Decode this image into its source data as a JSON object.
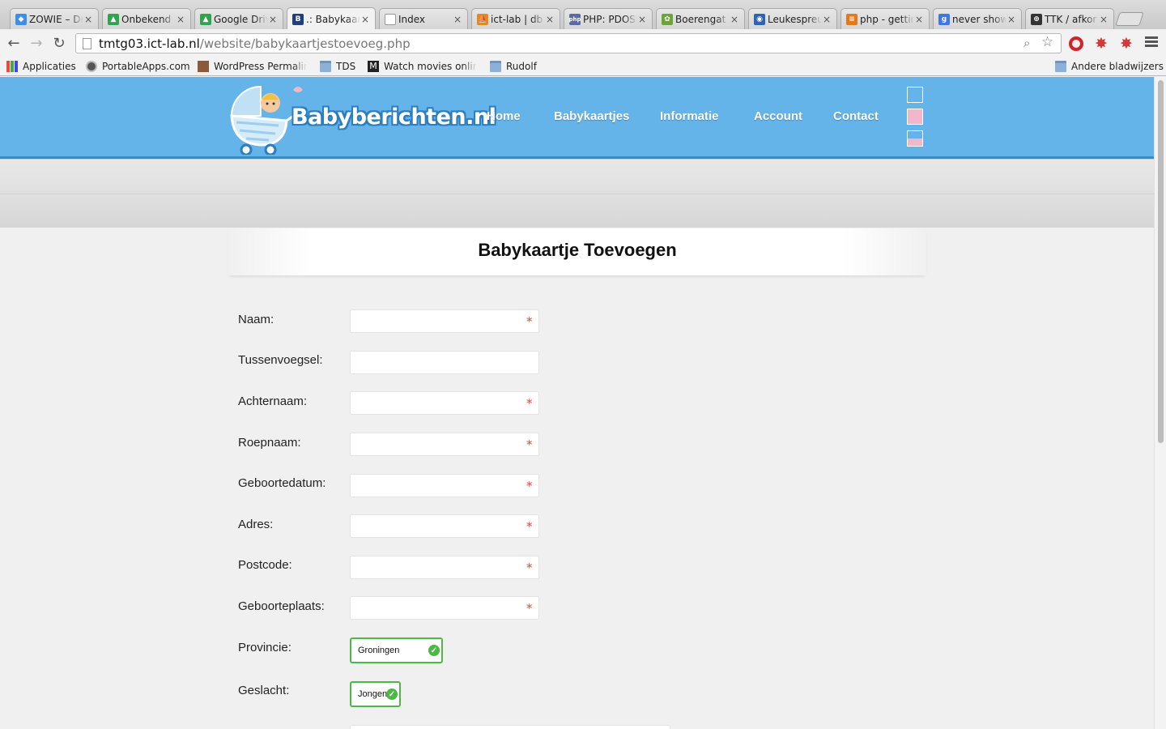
{
  "browser": {
    "tabs": [
      {
        "title": "ZOWIE – Dr",
        "favicon_color": "#3d8ee6",
        "favicon": "dropbox-icon"
      },
      {
        "title": "Onbekend -",
        "favicon_color": "#2fa44f",
        "favicon": "drive-icon"
      },
      {
        "title": "Google Driv",
        "favicon_color": "#2fa44f",
        "favicon": "drive-icon"
      },
      {
        "title": ".: Babykaart",
        "favicon_color": "#1e3f7a",
        "favicon": "b-icon",
        "favicon_glyph": "B"
      },
      {
        "title": "Index",
        "favicon_color": "#ffffff",
        "favicon": "page-icon"
      },
      {
        "title": "ict-lab | db",
        "favicon_color": "#e08a1f",
        "favicon": "pma-icon"
      },
      {
        "title": "PHP: PDOSt",
        "favicon_color": "#5b6aa3",
        "favicon": "php-icon",
        "favicon_glyph": "php"
      },
      {
        "title": "Boerengat",
        "favicon_color": "#6aa53a",
        "favicon": "site-icon"
      },
      {
        "title": "Leukespreu",
        "favicon_color": "#2d63b5",
        "favicon": "site-icon"
      },
      {
        "title": "php - gettin",
        "favicon_color": "#e07a1f",
        "favicon": "stackoverflow-icon"
      },
      {
        "title": "never show",
        "favicon_color": "#3f79e0",
        "favicon": "google-icon",
        "favicon_glyph": "g"
      },
      {
        "title": "TTK / afkor",
        "favicon_color": "#333333",
        "favicon": "ttk-icon"
      }
    ],
    "url_host": "tmtg03.ict-lab.nl",
    "url_path": "/website/babykaartjestoevoeg.php",
    "bookmarks": [
      {
        "label": "Applicaties",
        "icon": "apps-icon"
      },
      {
        "label": "PortableApps.com",
        "icon": "portableapps-icon"
      },
      {
        "label": "WordPress Permalink",
        "icon": "wordpress-icon"
      },
      {
        "label": "TDS",
        "icon": "folder-icon"
      },
      {
        "label": "Watch movies online",
        "icon": "movies-icon"
      },
      {
        "label": "Rudolf",
        "icon": "folder-icon"
      }
    ],
    "other_bookmarks": "Andere bladwijzers"
  },
  "site": {
    "logo_text": "Babyberichten.nl",
    "nav": [
      "Home",
      "Babykaartjes",
      "Informatie",
      "Account",
      "Contact"
    ],
    "theme_colors": [
      "#64b3e9",
      "#f3b7cc",
      "split"
    ]
  },
  "form": {
    "title": "Babykaartje Toevoegen",
    "required_mark": "*",
    "fields": [
      {
        "label": "Naam:",
        "required": true
      },
      {
        "label": "Tussenvoegsel:",
        "required": false
      },
      {
        "label": "Achternaam:",
        "required": true
      },
      {
        "label": "Roepnaam:",
        "required": true
      },
      {
        "label": "Geboortedatum:",
        "required": true
      },
      {
        "label": "Adres:",
        "required": true
      },
      {
        "label": "Postcode:",
        "required": true
      },
      {
        "label": "Geboorteplaats:",
        "required": true
      }
    ],
    "provincie": {
      "label": "Provincie:",
      "value": "Groningen"
    },
    "geslacht": {
      "label": "Geslacht:",
      "value": "Jongen"
    },
    "accent_valid": "#4cb944",
    "accent_required": "#e0453f"
  }
}
